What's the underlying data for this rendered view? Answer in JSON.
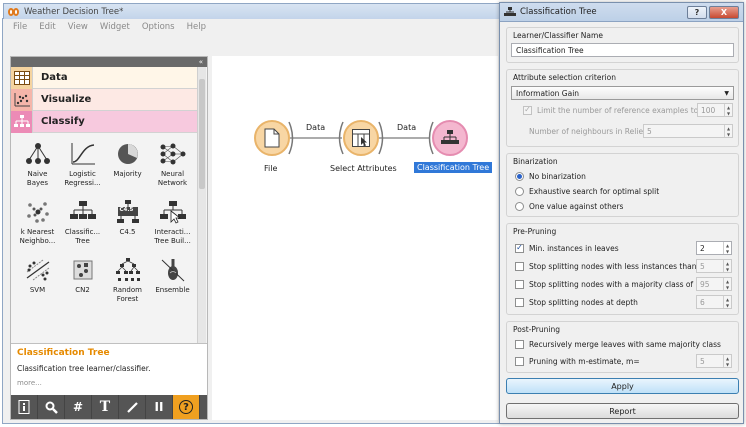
{
  "main_window": {
    "title": "Weather Decision Tree*",
    "menu": [
      "File",
      "Edit",
      "View",
      "Widget",
      "Options",
      "Help"
    ]
  },
  "panel": {
    "collapse_glyph": "«",
    "categories": [
      {
        "label": "Data",
        "icon": "table-icon"
      },
      {
        "label": "Visualize",
        "icon": "scatter-icon"
      },
      {
        "label": "Classify",
        "icon": "tree-icon"
      }
    ],
    "widgets": [
      {
        "label": "Naive\nBayes",
        "icon": "naive-bayes-icon"
      },
      {
        "label": "Logistic\nRegressi...",
        "icon": "logistic-regression-icon"
      },
      {
        "label": "Majority",
        "icon": "majority-icon"
      },
      {
        "label": "Neural\nNetwork",
        "icon": "neural-network-icon"
      },
      {
        "label": "k Nearest\nNeighbo...",
        "icon": "knn-icon"
      },
      {
        "label": "Classific...\nTree",
        "icon": "classification-tree-icon"
      },
      {
        "label": "C4.5",
        "icon": "c45-icon"
      },
      {
        "label": "Interacti...\nTree Buil...",
        "icon": "interactive-tree-icon"
      },
      {
        "label": "SVM",
        "icon": "svm-icon"
      },
      {
        "label": "CN2",
        "icon": "cn2-icon"
      },
      {
        "label": "Random\nForest",
        "icon": "random-forest-icon"
      },
      {
        "label": "Ensemble",
        "icon": "ensemble-icon"
      }
    ],
    "c45_badge": "C4.5",
    "description": {
      "title": "Classification Tree",
      "text": "Classification tree learner/classifier.",
      "more": "more..."
    },
    "toolbar_glyphs": {
      "find": "#",
      "text": "T",
      "pause": "II",
      "help": "?"
    }
  },
  "canvas": {
    "nodes": [
      {
        "label": "File"
      },
      {
        "label": "Select Attributes"
      },
      {
        "label": "Classification Tree"
      }
    ],
    "links": [
      "Data",
      "Data"
    ]
  },
  "dialog": {
    "title": "Classification Tree",
    "title_buttons": {
      "help": "?",
      "close": "X"
    },
    "learner_name": {
      "group_title": "Learner/Classifier Name",
      "value": "Classification Tree"
    },
    "attribute_selection": {
      "group_title": "Attribute selection criterion",
      "criterion": "Information Gain",
      "limit_reference_label": "Limit the number of reference examples to",
      "limit_reference_value": "100",
      "neighbours_label": "Number of neighbours in ReliefF",
      "neighbours_value": "5"
    },
    "binarization": {
      "group_title": "Binarization",
      "options": [
        "No binarization",
        "Exhaustive search for optimal split",
        "One value against others"
      ],
      "selected": 0
    },
    "pre_pruning": {
      "group_title": "Pre-Pruning",
      "min_instances_label": "Min. instances in leaves",
      "min_instances_value": "2",
      "stop_less_label": "Stop splitting nodes with less instances than",
      "stop_less_value": "5",
      "stop_majority_label": "Stop splitting nodes with a majority class of (%)",
      "stop_majority_value": "95",
      "stop_depth_label": "Stop splitting nodes at depth",
      "stop_depth_value": "6"
    },
    "post_pruning": {
      "group_title": "Post-Pruning",
      "recursive_merge_label": "Recursively merge leaves with same majority class",
      "m_estimate_label": "Pruning with m-estimate, m=",
      "m_estimate_value": "5"
    },
    "buttons": {
      "apply": "Apply",
      "report": "Report"
    }
  },
  "colors": {
    "data_category": "#f5d4a0",
    "visualize_category": "#f5b5aa",
    "classify_category": "#ec8bb6",
    "selected_label": "#3078d8",
    "description_title": "#e68a00"
  }
}
